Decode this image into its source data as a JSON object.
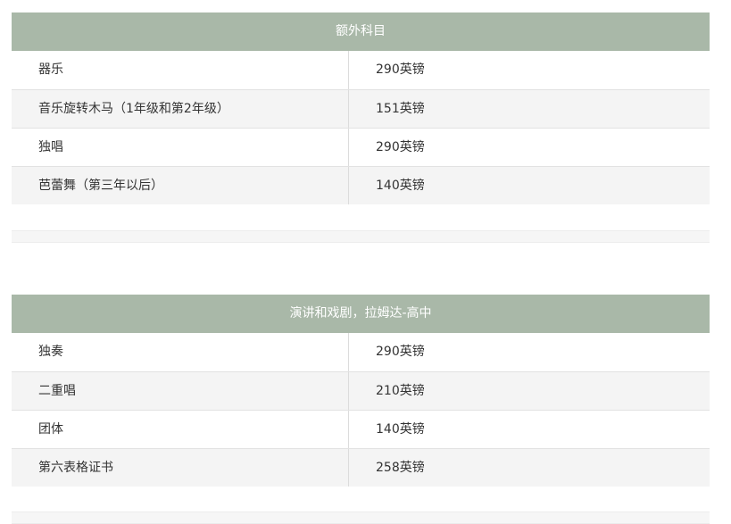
{
  "tables": [
    {
      "title": "额外科目",
      "rows": [
        {
          "name": "器乐",
          "price": "290英镑"
        },
        {
          "name": "音乐旋转木马（1年级和第2年级）",
          "price": "151英镑"
        },
        {
          "name": "独唱",
          "price": "290英镑"
        },
        {
          "name": "芭蕾舞（第三年以后）",
          "price": "140英镑"
        }
      ]
    },
    {
      "title": "演讲和戏剧，拉姆达-高中",
      "rows": [
        {
          "name": "独奏",
          "price": "290英镑"
        },
        {
          "name": "二重唱",
          "price": "210英镑"
        },
        {
          "name": "团体",
          "price": "140英镑"
        },
        {
          "name": "第六表格证书",
          "price": "258英镑"
        }
      ]
    }
  ],
  "colors": {
    "header_bg": "#a9b8a8",
    "header_text": "#ffffff",
    "row_alt_bg": "#f4f4f4"
  }
}
